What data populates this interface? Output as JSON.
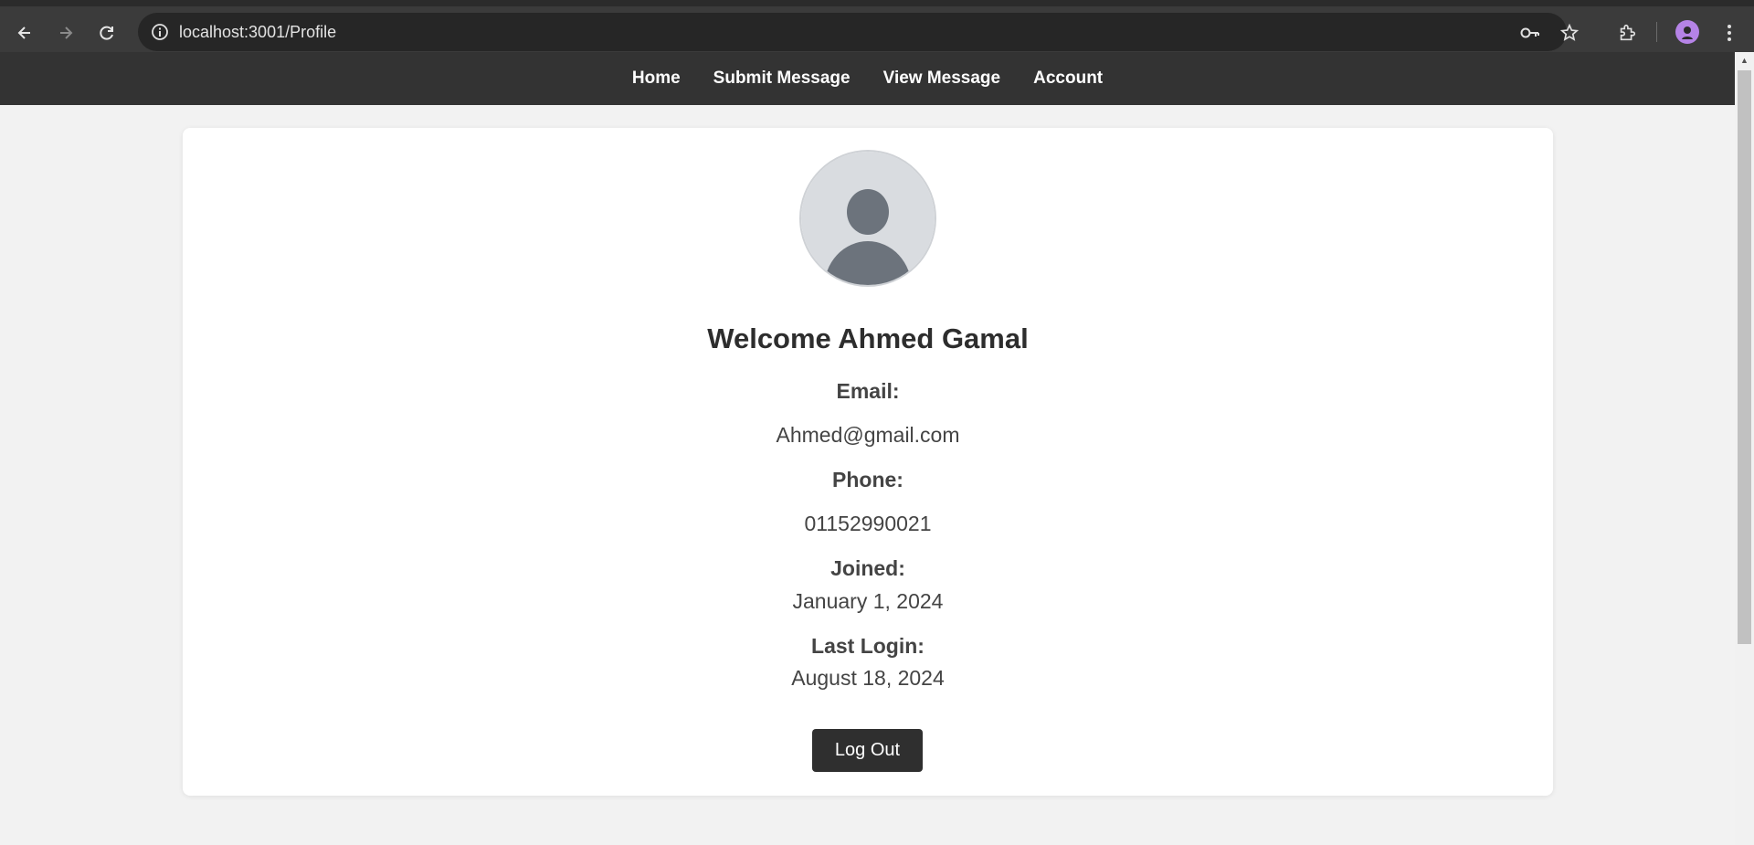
{
  "browser": {
    "url": "localhost:3001/Profile",
    "icons": {
      "back": "arrow-left-icon",
      "forward": "arrow-right-icon",
      "reload": "reload-icon",
      "info": "info-icon",
      "password": "key-icon",
      "bookmark": "star-icon",
      "extensions": "puzzle-icon",
      "menu": "kebab-menu-icon"
    }
  },
  "nav": {
    "items": [
      {
        "label": "Home"
      },
      {
        "label": "Submit Message"
      },
      {
        "label": "View Message"
      },
      {
        "label": "Account"
      }
    ]
  },
  "profile": {
    "welcome": "Welcome Ahmed Gamal",
    "email_label": "Email:",
    "email": "Ahmed@gmail.com",
    "phone_label": "Phone:",
    "phone": "01152990021",
    "joined_label": "Joined:",
    "joined": "January 1, 2024",
    "last_login_label": "Last Login:",
    "last_login": "August 18, 2024",
    "logout_label": "Log Out"
  },
  "colors": {
    "nav_bg": "#333333",
    "page_bg": "#f2f2f2",
    "card_bg": "#ffffff",
    "button_bg": "#2f2f2f",
    "avatar_bg": "#d9dce0",
    "avatar_fg": "#6c737c"
  }
}
